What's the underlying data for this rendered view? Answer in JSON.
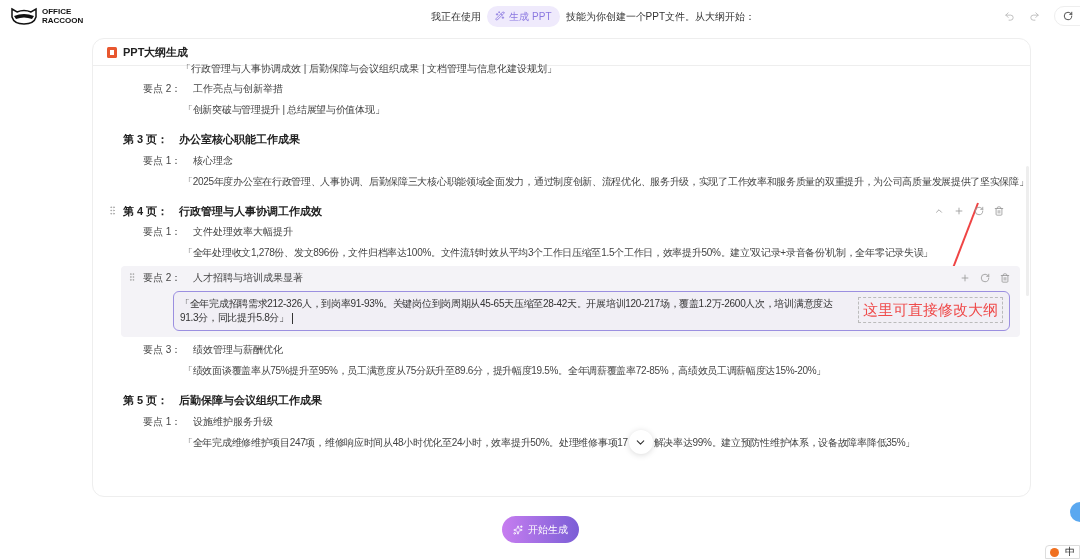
{
  "header": {
    "logo_lines": [
      "OFFICE",
      "RACCOON"
    ],
    "prompt_before": "我正在使用",
    "skill_chip": "生成 PPT",
    "prompt_after": "技能为你创建一个PPT文件。从大纲开始："
  },
  "card": {
    "title": "PPT大纲生成"
  },
  "outline": [
    {
      "kind": "fragment",
      "text": "「行政管理与人事协调成效 | 后勤保障与会议组织成果 | 文档管理与信息化建设规划」"
    },
    {
      "kind": "point",
      "label": "要点 2：",
      "title": "工作亮点与创新举措",
      "detail": "「创新突破与管理提升 | 总结展望与价值体现」",
      "editing": false
    },
    {
      "kind": "page",
      "label": "第 3 页：",
      "title": "办公室核心职能工作成果",
      "hovered": false
    },
    {
      "kind": "point",
      "label": "要点 1：",
      "title": "核心理念",
      "detail": "「2025年度办公室在行政管理、人事协调、后勤保障三大核心职能领域全面发力，通过制度创新、流程优化、服务升级，实现了工作效率和服务质量的双重提升，为公司高质量发展提供了坚实保障」",
      "editing": false
    },
    {
      "kind": "page",
      "label": "第 4 页：",
      "title": "行政管理与人事协调工作成效",
      "hovered": true
    },
    {
      "kind": "point",
      "label": "要点 1：",
      "title": "文件处理效率大幅提升",
      "detail": "「全年处理收文1,278份、发文896份，文件归档率达100%。文件流转时效从平均3个工作日压缩至1.5个工作日，效率提升50%。建立'双记录+录音备份'机制，全年零记录失误」",
      "editing": false
    },
    {
      "kind": "point",
      "label": "要点 2：",
      "title": "人才招聘与培训成果显著",
      "detail": "「全年完成招聘需求212-326人，到岗率91-93%。关键岗位到岗周期从45-65天压缩至28-42天。开展培训120-217场，覆盖1.2万-2600人次，培训满意度达91.3分，同比提升5.8分」",
      "editing": true
    },
    {
      "kind": "point",
      "label": "要点 3：",
      "title": "绩效管理与薪酬优化",
      "detail": "「绩效面谈覆盖率从75%提升至95%，员工满意度从75分跃升至89.6分，提升幅度19.5%。全年调薪覆盖率72-85%，高绩效员工调薪幅度达15%-20%」",
      "editing": false
    },
    {
      "kind": "page",
      "label": "第 5 页：",
      "title": "后勤保障与会议组织工作成果",
      "hovered": false
    },
    {
      "kind": "point",
      "label": "要点 1：",
      "title": "设施维护服务升级",
      "detail": "「全年完成维修维护项目247项，维修响应时间从48小时优化至24小时，效率提升50%。处理维修事项17",
      "detail_after": "解决率达99%。建立预防性维护体系，设备故障率降低35%」",
      "editing": false
    }
  ],
  "annotation": {
    "text": "这里可直接修改大纲"
  },
  "generate_button": {
    "label": "开始生成"
  },
  "tray": {
    "ime": "中"
  }
}
